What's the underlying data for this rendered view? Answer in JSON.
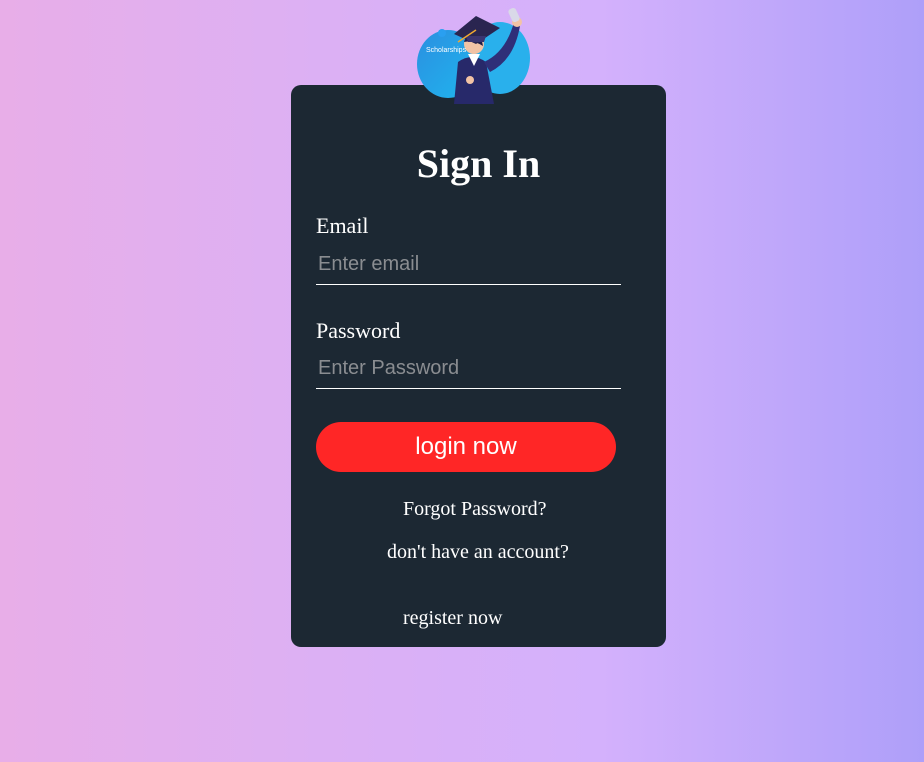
{
  "logo": {
    "text": "Scholarships"
  },
  "form": {
    "title": "Sign In",
    "email_label": "Email",
    "email_placeholder": "Enter email",
    "password_label": "Password",
    "password_placeholder": "Enter Password",
    "login_label": "login now",
    "forgot_label": "Forgot Password?",
    "no_account_label": "don't have an account?",
    "register_label": "register now"
  },
  "colors": {
    "card": "#1c2833",
    "button": "#ff2626",
    "text": "#ffffff"
  }
}
